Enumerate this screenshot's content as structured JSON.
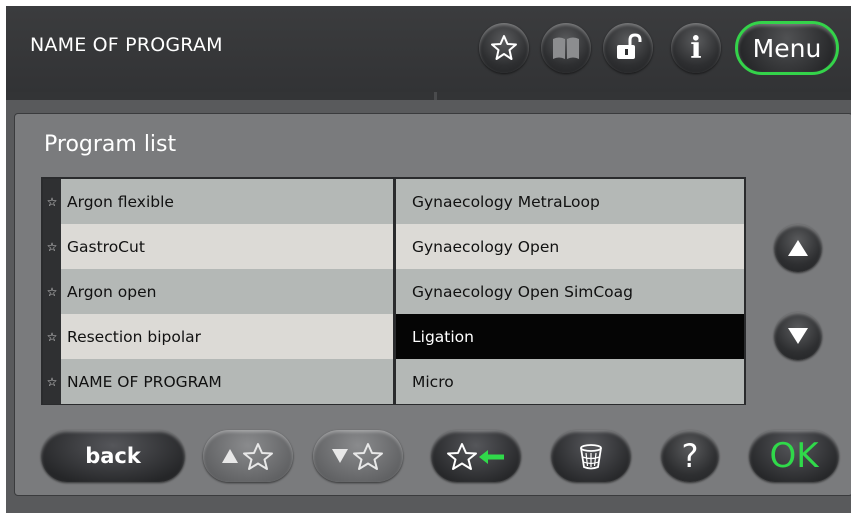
{
  "header": {
    "title": "NAME OF PROGRAM",
    "menu_label": "Menu",
    "info_glyph": "i"
  },
  "panel": {
    "title": "Program list"
  },
  "list": {
    "left": [
      {
        "label": "Argon flexible"
      },
      {
        "label": "GastroCut"
      },
      {
        "label": "Argon open"
      },
      {
        "label": "Resection bipolar"
      },
      {
        "label": "NAME OF PROGRAM"
      }
    ],
    "right": [
      {
        "label": "Gynaecology MetraLoop"
      },
      {
        "label": "Gynaecology Open"
      },
      {
        "label": "Gynaecology Open SimCoag"
      },
      {
        "label": "Ligation",
        "selected": true
      },
      {
        "label": "Micro"
      }
    ]
  },
  "footer": {
    "back_label": "back",
    "help_label": "?",
    "ok_label": "OK"
  },
  "colors": {
    "accent_green": "#34d34a",
    "selected_row": "#050505"
  },
  "icons": [
    "star-icon",
    "book-icon",
    "unlock-icon",
    "info-icon",
    "scroll-up-icon",
    "scroll-down-icon",
    "move-favorite-up-icon",
    "move-favorite-down-icon",
    "add-favorite-icon",
    "trash-icon"
  ]
}
